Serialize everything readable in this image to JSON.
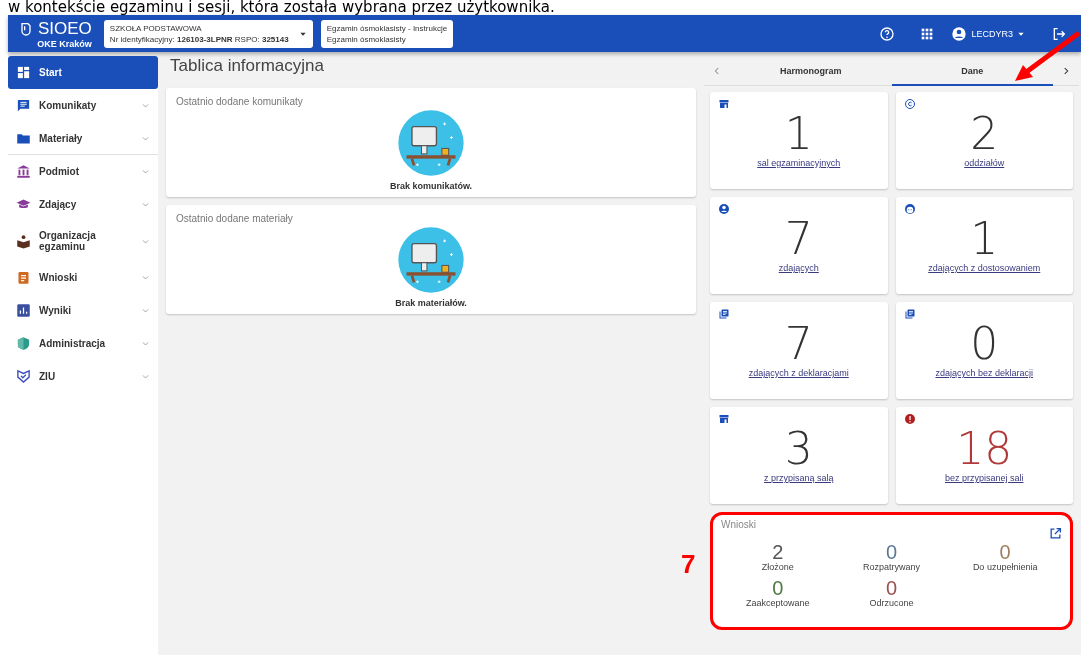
{
  "caption": "w kontekście egzaminu i sesji, która została wybrana przez użytkownika.",
  "header": {
    "logo_title": "SIOEO",
    "logo_subtitle": "OKE Kraków",
    "school": {
      "type": "SZKOŁA PODSTAWOWA",
      "id_label": "Nr identyfikacyjny:",
      "id_value": "126103-3LPNR",
      "rspo_label": "RSPO:",
      "rspo_value": "325143"
    },
    "exam": {
      "line_1": "Egzamin ósmoklasisty - Instrukcje",
      "line_2": "Egzamin ósmoklasisty"
    },
    "user": "LECDYR3"
  },
  "sidebar": {
    "items": [
      {
        "label": "Start",
        "kind": "dashboard",
        "selected": true,
        "expandable": false
      },
      {
        "label": "Komunikaty",
        "kind": "message",
        "selected": false,
        "expandable": true
      },
      {
        "label": "Materiały",
        "kind": "folder",
        "selected": false,
        "expandable": true
      },
      {
        "label": "Podmiot",
        "kind": "building",
        "selected": false,
        "expandable": true
      },
      {
        "label": "Zdający",
        "kind": "cap",
        "selected": false,
        "expandable": true
      },
      {
        "label": "Organizacja egzaminu",
        "kind": "reader",
        "selected": false,
        "expandable": true
      },
      {
        "label": "Wnioski",
        "kind": "clipboard",
        "selected": false,
        "expandable": true
      },
      {
        "label": "Wyniki",
        "kind": "chart",
        "selected": false,
        "expandable": true
      },
      {
        "label": "Administracja",
        "kind": "shield",
        "selected": false,
        "expandable": true
      },
      {
        "label": "ZIU",
        "kind": "badge",
        "selected": false,
        "expandable": true
      }
    ]
  },
  "main": {
    "title": "Tablica informacyjna",
    "cards": [
      {
        "title": "Ostatnio dodane komunikaty",
        "empty_text": "Brak komunikatów."
      },
      {
        "title": "Ostatnio dodane materiały",
        "empty_text": "Brak materiałów."
      }
    ]
  },
  "tabs": [
    {
      "label": "Harmonogram",
      "selected": false
    },
    {
      "label": "Dane",
      "selected": true
    }
  ],
  "tiles": [
    {
      "kind": "room",
      "value": "1",
      "label": "sal egzaminacyjnych",
      "alert": false
    },
    {
      "kind": "class",
      "value": "2",
      "label": "oddziałów",
      "alert": false
    },
    {
      "kind": "person",
      "value": "7",
      "label": "zdających",
      "alert": false
    },
    {
      "kind": "face",
      "value": "1",
      "label": "zdających z dostosowaniem",
      "alert": false
    },
    {
      "kind": "docs",
      "value": "7",
      "label": "zdających z deklaracjami",
      "alert": false
    },
    {
      "kind": "docs",
      "value": "0",
      "label": "zdających bez deklaracji",
      "alert": false
    },
    {
      "kind": "room",
      "value": "3",
      "label": "z przypisaną salą",
      "alert": false
    },
    {
      "kind": "error",
      "value": "18",
      "label": "bez przypisanej sali",
      "alert": true
    }
  ],
  "requests": {
    "title": "Wnioski",
    "stats": [
      {
        "value": "2",
        "label": "Złożone",
        "color": "#555555"
      },
      {
        "value": "0",
        "label": "Rozpatrywany",
        "color": "#5a7a9a"
      },
      {
        "value": "0",
        "label": "Do uzupełnienia",
        "color": "#a08060"
      },
      {
        "value": "0",
        "label": "Zaakceptowane",
        "color": "#4f7a45"
      },
      {
        "value": "0",
        "label": "Odrzucone",
        "color": "#a05050"
      }
    ]
  },
  "annotation": {
    "label": "7"
  }
}
